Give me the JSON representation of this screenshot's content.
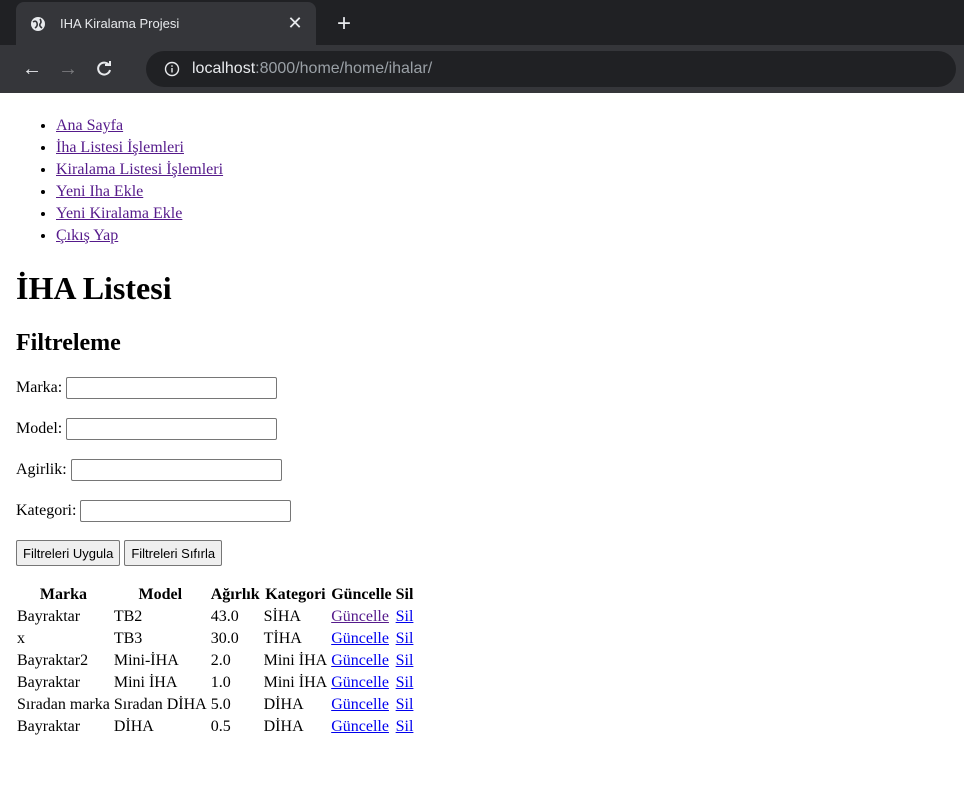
{
  "browser": {
    "tab_title": "IHA Kiralama Projesi",
    "url_host": "localhost",
    "url_rest": ":8000/home/home/ihalar/"
  },
  "nav": [
    {
      "label": "Ana Sayfa"
    },
    {
      "label": "İha Listesi İşlemleri"
    },
    {
      "label": "Kiralama Listesi İşlemleri"
    },
    {
      "label": "Yeni Iha Ekle"
    },
    {
      "label": "Yeni Kiralama Ekle"
    },
    {
      "label": "Çıkış Yap"
    }
  ],
  "page_title": "İHA Listesi",
  "filter": {
    "heading": "Filtreleme",
    "fields": [
      {
        "label": "Marka:",
        "value": ""
      },
      {
        "label": "Model:",
        "value": ""
      },
      {
        "label": "Agirlik:",
        "value": ""
      },
      {
        "label": "Kategori:",
        "value": ""
      }
    ],
    "apply_label": "Filtreleri Uygula",
    "reset_label": "Filtreleri Sıfırla"
  },
  "table": {
    "headers": [
      "Marka",
      "Model",
      "Ağırlık",
      "Kategori",
      "Güncelle",
      "Sil"
    ],
    "rows": [
      {
        "marka": "Bayraktar",
        "model": "TB2",
        "agirlik": "43.0",
        "kategori": "SİHA",
        "update": "Güncelle",
        "delete": "Sil"
      },
      {
        "marka": "x",
        "model": "TB3",
        "agirlik": "30.0",
        "kategori": "TİHA",
        "update": "Güncelle",
        "delete": "Sil"
      },
      {
        "marka": "Bayraktar2",
        "model": "Mini-İHA",
        "agirlik": "2.0",
        "kategori": "Mini İHA",
        "update": "Güncelle",
        "delete": "Sil"
      },
      {
        "marka": "Bayraktar",
        "model": "Mini İHA",
        "agirlik": "1.0",
        "kategori": "Mini İHA",
        "update": "Güncelle",
        "delete": "Sil"
      },
      {
        "marka": "Sıradan marka",
        "model": "Sıradan DİHA",
        "agirlik": "5.0",
        "kategori": "DİHA",
        "update": "Güncelle",
        "delete": "Sil"
      },
      {
        "marka": "Bayraktar",
        "model": "DİHA",
        "agirlik": "0.5",
        "kategori": "DİHA",
        "update": "Güncelle",
        "delete": "Sil"
      }
    ]
  }
}
